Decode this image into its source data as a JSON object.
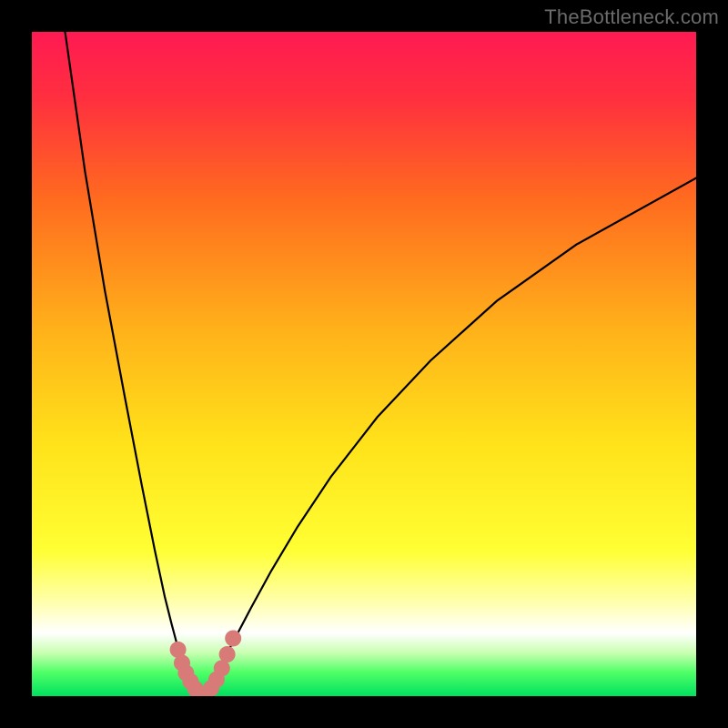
{
  "attribution": "TheBottleneck.com",
  "chart_data": {
    "type": "line",
    "title": "",
    "xlabel": "",
    "ylabel": "",
    "xlim": [
      0,
      100
    ],
    "ylim": [
      0,
      100
    ],
    "background_gradient": {
      "stops": [
        {
          "offset": 0.0,
          "color": "#ff1a52"
        },
        {
          "offset": 0.1,
          "color": "#ff2f3f"
        },
        {
          "offset": 0.25,
          "color": "#ff6a1f"
        },
        {
          "offset": 0.45,
          "color": "#ffb21a"
        },
        {
          "offset": 0.62,
          "color": "#ffe21a"
        },
        {
          "offset": 0.78,
          "color": "#ffff33"
        },
        {
          "offset": 0.86,
          "color": "#ffffb0"
        },
        {
          "offset": 0.905,
          "color": "#ffffff"
        },
        {
          "offset": 0.935,
          "color": "#c8ffb0"
        },
        {
          "offset": 0.965,
          "color": "#4dff66"
        },
        {
          "offset": 1.0,
          "color": "#00e060"
        }
      ]
    },
    "series": [
      {
        "name": "left-branch",
        "x": [
          5.0,
          8.0,
          11.0,
          14.0,
          16.5,
          18.5,
          20.0,
          21.0,
          21.8,
          22.5,
          23.0,
          23.5,
          24.0,
          24.6,
          25.5
        ],
        "y": [
          100.0,
          79.0,
          61.0,
          45.0,
          32.0,
          22.0,
          15.0,
          11.0,
          8.0,
          6.0,
          4.5,
          3.3,
          2.3,
          1.3,
          0.1
        ]
      },
      {
        "name": "right-branch",
        "x": [
          25.5,
          26.4,
          27.3,
          28.3,
          29.5,
          31.0,
          33.0,
          36.0,
          40.0,
          45.0,
          52.0,
          60.0,
          70.0,
          82.0,
          100.0
        ],
        "y": [
          0.1,
          1.4,
          2.8,
          4.5,
          6.7,
          9.5,
          13.3,
          18.8,
          25.5,
          33.0,
          42.0,
          50.5,
          59.5,
          68.0,
          78.0
        ]
      }
    ],
    "markers": {
      "name": "near-minimum-dots",
      "color": "#d77a78",
      "radius_px": 9,
      "points": [
        {
          "x": 22.0,
          "y": 7.0
        },
        {
          "x": 22.6,
          "y": 5.0
        },
        {
          "x": 23.2,
          "y": 3.5
        },
        {
          "x": 23.9,
          "y": 2.2
        },
        {
          "x": 24.6,
          "y": 1.1
        },
        {
          "x": 25.4,
          "y": 0.3
        },
        {
          "x": 26.2,
          "y": 0.3
        },
        {
          "x": 27.0,
          "y": 1.2
        },
        {
          "x": 27.8,
          "y": 2.5
        },
        {
          "x": 28.6,
          "y": 4.2
        },
        {
          "x": 29.4,
          "y": 6.3
        },
        {
          "x": 30.3,
          "y": 8.7
        }
      ]
    }
  }
}
